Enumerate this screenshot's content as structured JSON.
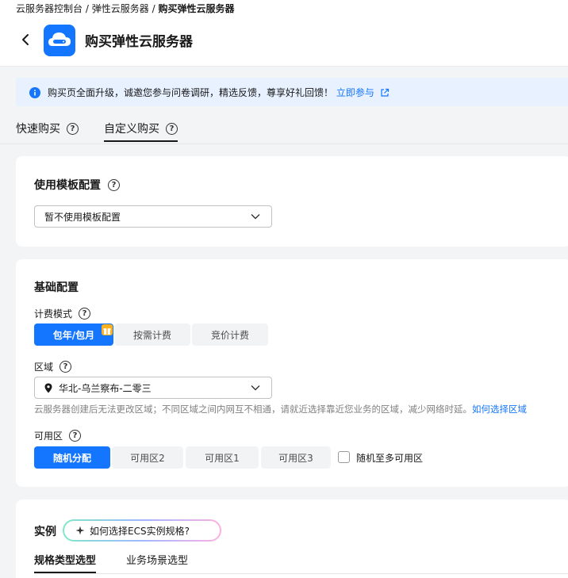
{
  "breadcrumb": {
    "items": [
      "云服务器控制台",
      "弹性云服务器"
    ],
    "current": "购买弹性云服务器",
    "separator": "/"
  },
  "header": {
    "title": "购买弹性云服务器"
  },
  "notice": {
    "text": "购买页全面升级，诚邀您参与问卷调研，精选反馈，尊享好礼回馈！",
    "link": "立即参与"
  },
  "tabs": [
    {
      "label": "快速购买"
    },
    {
      "label": "自定义购买"
    }
  ],
  "template": {
    "heading": "使用模板配置",
    "select_value": "暂不使用模板配置"
  },
  "basic": {
    "heading": "基础配置",
    "billing_label": "计费模式",
    "billing_options": [
      "包年/包月",
      "按需计费",
      "竞价计费"
    ],
    "region_label": "区域",
    "region_value": "华北-乌兰察布-二零三",
    "region_hint": "云服务器创建后无法更改区域；不同区域之间内网互不相通，请就近选择靠近您业务的区域，减少网络时延。",
    "region_hint_link": "如何选择区域",
    "az_label": "可用区",
    "az_options": [
      "随机分配",
      "可用区2",
      "可用区1",
      "可用区3"
    ],
    "az_random_label": "随机至多可用区"
  },
  "instance": {
    "heading": "实例",
    "ai_button": "如何选择ECS实例规格?",
    "subtabs": [
      "规格类型选型",
      "业务场景选型"
    ]
  },
  "colors": {
    "primary": "#1476ff",
    "notice_bg": "#e8f1ff",
    "page_bg": "#f3f4f6"
  }
}
